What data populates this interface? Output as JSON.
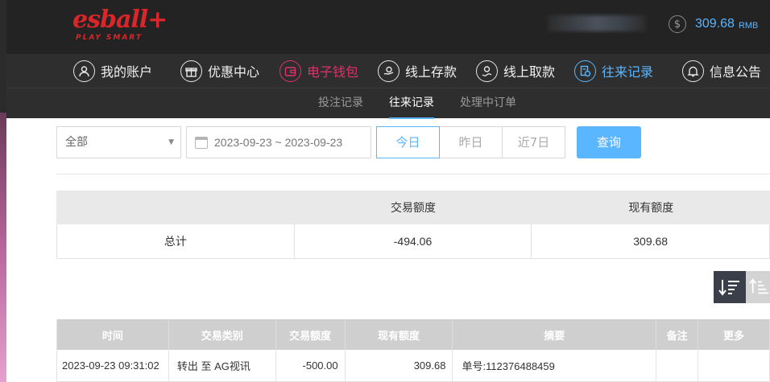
{
  "header": {
    "logo_text": "esball+",
    "logo_tagline": "PLAY SMART",
    "balance_icon": "$",
    "balance_amount": "309.68",
    "balance_currency": "RMB"
  },
  "nav": {
    "items": [
      {
        "label": "我的账户",
        "icon": "user-icon"
      },
      {
        "label": "优惠中心",
        "icon": "gift-icon"
      },
      {
        "label": "电子钱包",
        "icon": "wallet-icon"
      },
      {
        "label": "线上存款",
        "icon": "deposit-icon"
      },
      {
        "label": "线上取款",
        "icon": "withdraw-icon"
      },
      {
        "label": "往来记录",
        "icon": "records-icon"
      },
      {
        "label": "信息公告",
        "icon": "bell-icon"
      }
    ],
    "active_index": 5
  },
  "subnav": {
    "items": [
      "投注记录",
      "往来记录",
      "处理中订单"
    ],
    "active_index": 1
  },
  "filters": {
    "type_select": "全部",
    "date_range": "2023-09-23 ~ 2023-09-23",
    "quick_buttons": [
      "今日",
      "昨日",
      "近7日"
    ],
    "active_quick": 0,
    "query_label": "查询"
  },
  "summary": {
    "headers": [
      "",
      "交易额度",
      "现有额度"
    ],
    "row": [
      "总计",
      "-494.06",
      "309.68"
    ]
  },
  "records": {
    "headers": [
      "时间",
      "交易类别",
      "交易额度",
      "现有额度",
      "摘要",
      "备注",
      "更多"
    ],
    "rows": [
      [
        "2023-09-23 09:31:02",
        "转出 至 AG视讯",
        "-500.00",
        "309.68",
        "单号:112376488459",
        "",
        ""
      ]
    ]
  },
  "colors": {
    "accent": "#5ab6ff",
    "wallet": "#e0326a",
    "brand": "#d9262a",
    "header_bg": "#232323",
    "nav_bg": "#2e2e2e"
  }
}
